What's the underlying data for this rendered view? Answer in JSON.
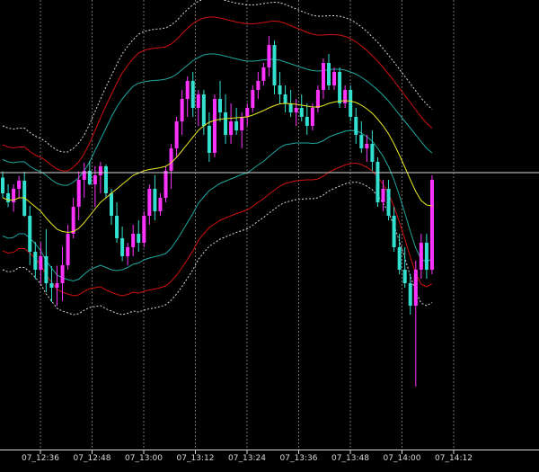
{
  "chart_data": {
    "type": "candlestick",
    "title": "",
    "x_ticks": [
      "07_12:36",
      "07_12:48",
      "07_13:00",
      "07_13:12",
      "07_13:24",
      "07_13:36",
      "07_13:48",
      "07_14:00",
      "07_14:12"
    ],
    "ylim": [
      0,
      100
    ],
    "grid": "vertical dashed",
    "price_line_y": 61.6,
    "colors": {
      "background": "#000000",
      "up_candle": "#ff33ff",
      "down_candle": "#33e0d0",
      "moving_average": "#e8e820",
      "band_inner": "#1fa7a0",
      "band_middle": "#d01010",
      "band_outer": "#d8d8d8",
      "price_line": "#d8d8d8",
      "grid": "#ffffff"
    },
    "candles": [
      {
        "o": 60.5,
        "h": 61.9,
        "l": 56.0,
        "c": 57.0
      },
      {
        "o": 57.0,
        "h": 59.0,
        "l": 53.9,
        "c": 55.0
      },
      {
        "o": 55.0,
        "h": 59.0,
        "l": 52.9,
        "c": 58.0
      },
      {
        "o": 58.0,
        "h": 60.9,
        "l": 55.8,
        "c": 59.8
      },
      {
        "o": 59.8,
        "h": 61.8,
        "l": 51.8,
        "c": 52.0
      },
      {
        "o": 52.0,
        "h": 54.2,
        "l": 41.0,
        "c": 44.0
      },
      {
        "o": 44.0,
        "h": 46.2,
        "l": 37.9,
        "c": 40.0
      },
      {
        "o": 40.0,
        "h": 46.0,
        "l": 36.9,
        "c": 43.0
      },
      {
        "o": 43.0,
        "h": 49.0,
        "l": 35.0,
        "c": 37.0
      },
      {
        "o": 37.0,
        "h": 40.8,
        "l": 32.8,
        "c": 36.0
      },
      {
        "o": 36.0,
        "h": 40.9,
        "l": 31.9,
        "c": 37.0
      },
      {
        "o": 37.0,
        "h": 45.1,
        "l": 33.0,
        "c": 41.0
      },
      {
        "o": 41.0,
        "h": 50.0,
        "l": 40.0,
        "c": 48.0
      },
      {
        "o": 48.0,
        "h": 56.0,
        "l": 47.0,
        "c": 54.0
      },
      {
        "o": 54.0,
        "h": 61.9,
        "l": 51.0,
        "c": 60.0
      },
      {
        "o": 60.0,
        "h": 63.8,
        "l": 56.0,
        "c": 62.0
      },
      {
        "o": 62.0,
        "h": 64.2,
        "l": 58.8,
        "c": 59.0
      },
      {
        "o": 59.0,
        "h": 63.0,
        "l": 54.0,
        "c": 61.0
      },
      {
        "o": 61.0,
        "h": 64.0,
        "l": 57.0,
        "c": 63.0
      },
      {
        "o": 63.0,
        "h": 63.4,
        "l": 56.0,
        "c": 57.0
      },
      {
        "o": 57.0,
        "h": 58.0,
        "l": 50.0,
        "c": 52.0
      },
      {
        "o": 52.0,
        "h": 55.0,
        "l": 46.0,
        "c": 47.0
      },
      {
        "o": 47.0,
        "h": 49.6,
        "l": 41.9,
        "c": 43.0
      },
      {
        "o": 43.0,
        "h": 46.0,
        "l": 41.0,
        "c": 45.0
      },
      {
        "o": 45.0,
        "h": 50.0,
        "l": 43.0,
        "c": 48.0
      },
      {
        "o": 48.0,
        "h": 51.0,
        "l": 44.0,
        "c": 46.0
      },
      {
        "o": 46.0,
        "h": 53.0,
        "l": 45.0,
        "c": 52.0
      },
      {
        "o": 52.0,
        "h": 59.0,
        "l": 50.0,
        "c": 58.0
      },
      {
        "o": 58.0,
        "h": 61.0,
        "l": 51.0,
        "c": 53.0
      },
      {
        "o": 53.0,
        "h": 57.0,
        "l": 52.0,
        "c": 56.0
      },
      {
        "o": 56.0,
        "h": 63.0,
        "l": 55.0,
        "c": 62.0
      },
      {
        "o": 62.0,
        "h": 68.0,
        "l": 58.0,
        "c": 67.0
      },
      {
        "o": 67.0,
        "h": 74.0,
        "l": 65.0,
        "c": 73.0
      },
      {
        "o": 73.0,
        "h": 80.0,
        "l": 70.0,
        "c": 78.0
      },
      {
        "o": 78.0,
        "h": 83.0,
        "l": 74.0,
        "c": 82.0
      },
      {
        "o": 82.0,
        "h": 84.0,
        "l": 74.0,
        "c": 76.0
      },
      {
        "o": 76.0,
        "h": 80.0,
        "l": 72.0,
        "c": 79.0
      },
      {
        "o": 79.0,
        "h": 80.0,
        "l": 70.0,
        "c": 72.0
      },
      {
        "o": 72.0,
        "h": 75.0,
        "l": 64.0,
        "c": 66.0
      },
      {
        "o": 66.0,
        "h": 79.0,
        "l": 65.0,
        "c": 78.0
      },
      {
        "o": 78.0,
        "h": 82.0,
        "l": 73.0,
        "c": 75.0
      },
      {
        "o": 75.0,
        "h": 79.0,
        "l": 68.0,
        "c": 70.0
      },
      {
        "o": 70.0,
        "h": 77.0,
        "l": 68.0,
        "c": 73.0
      },
      {
        "o": 73.0,
        "h": 76.0,
        "l": 70.0,
        "c": 71.0
      },
      {
        "o": 71.0,
        "h": 75.0,
        "l": 67.0,
        "c": 74.0
      },
      {
        "o": 74.0,
        "h": 77.0,
        "l": 72.0,
        "c": 76.0
      },
      {
        "o": 76.0,
        "h": 81.0,
        "l": 75.0,
        "c": 80.0
      },
      {
        "o": 80.0,
        "h": 84.0,
        "l": 78.0,
        "c": 82.0
      },
      {
        "o": 82.0,
        "h": 86.0,
        "l": 81.0,
        "c": 85.0
      },
      {
        "o": 85.0,
        "h": 92.0,
        "l": 83.0,
        "c": 90.0
      },
      {
        "o": 90.0,
        "h": 91.0,
        "l": 79.0,
        "c": 81.0
      },
      {
        "o": 81.0,
        "h": 84.0,
        "l": 77.0,
        "c": 79.0
      },
      {
        "o": 79.0,
        "h": 81.0,
        "l": 75.0,
        "c": 77.0
      },
      {
        "o": 77.0,
        "h": 80.0,
        "l": 74.0,
        "c": 75.0
      },
      {
        "o": 75.0,
        "h": 78.0,
        "l": 72.0,
        "c": 76.0
      },
      {
        "o": 76.0,
        "h": 79.0,
        "l": 73.0,
        "c": 74.0
      },
      {
        "o": 74.0,
        "h": 77.0,
        "l": 70.0,
        "c": 72.0
      },
      {
        "o": 72.0,
        "h": 77.0,
        "l": 71.0,
        "c": 76.0
      },
      {
        "o": 76.0,
        "h": 81.0,
        "l": 75.0,
        "c": 80.0
      },
      {
        "o": 80.0,
        "h": 87.0,
        "l": 78.0,
        "c": 86.0
      },
      {
        "o": 86.0,
        "h": 88.0,
        "l": 80.0,
        "c": 81.0
      },
      {
        "o": 81.0,
        "h": 85.0,
        "l": 80.0,
        "c": 84.0
      },
      {
        "o": 84.0,
        "h": 85.0,
        "l": 76.0,
        "c": 77.0
      },
      {
        "o": 77.0,
        "h": 81.0,
        "l": 76.0,
        "c": 80.0
      },
      {
        "o": 80.0,
        "h": 81.0,
        "l": 73.0,
        "c": 74.0
      },
      {
        "o": 74.0,
        "h": 76.0,
        "l": 68.0,
        "c": 70.0
      },
      {
        "o": 70.0,
        "h": 73.0,
        "l": 66.0,
        "c": 67.0
      },
      {
        "o": 67.0,
        "h": 70.0,
        "l": 64.0,
        "c": 68.0
      },
      {
        "o": 68.0,
        "h": 71.0,
        "l": 62.0,
        "c": 64.0
      },
      {
        "o": 64.0,
        "h": 65.0,
        "l": 54.0,
        "c": 55.0
      },
      {
        "o": 55.0,
        "h": 60.0,
        "l": 53.0,
        "c": 58.0
      },
      {
        "o": 58.0,
        "h": 60.0,
        "l": 51.0,
        "c": 52.0
      },
      {
        "o": 52.0,
        "h": 54.0,
        "l": 44.0,
        "c": 45.0
      },
      {
        "o": 45.0,
        "h": 48.0,
        "l": 39.0,
        "c": 40.0
      },
      {
        "o": 40.0,
        "h": 45.0,
        "l": 36.0,
        "c": 37.0
      },
      {
        "o": 37.0,
        "h": 39.0,
        "l": 30.0,
        "c": 32.0
      },
      {
        "o": 32.0,
        "h": 42.0,
        "l": 14.0,
        "c": 40.0
      },
      {
        "o": 40.0,
        "h": 48.0,
        "l": 38.0,
        "c": 46.0
      },
      {
        "o": 46.0,
        "h": 48.0,
        "l": 38.0,
        "c": 40.0
      },
      {
        "o": 40.0,
        "h": 61.0,
        "l": 39.0,
        "c": 60.0
      }
    ],
    "moving_average": [
      56,
      55.5,
      55.5,
      56,
      56,
      55,
      54,
      53,
      51.5,
      50.2,
      49,
      48.5,
      48.3,
      48.5,
      49.2,
      50.5,
      52,
      53.5,
      55,
      56,
      57,
      58,
      59,
      60,
      61,
      61.5,
      62,
      62.3,
      62.5,
      62.7,
      63,
      63.8,
      65,
      66.5,
      68,
      69.5,
      71,
      72,
      72.8,
      73.2,
      73.5,
      73.6,
      73.7,
      73.8,
      73.9,
      74,
      74.4,
      74.9,
      75.4,
      76,
      76.5,
      76.9,
      77,
      76.9,
      76.8,
      76.6,
      76.4,
      76.2,
      76.2,
      76.5,
      77,
      77.3,
      77.5,
      77.6,
      77.5,
      77.2,
      76.6,
      75.8,
      74.8,
      73.5,
      72,
      70.2,
      68,
      65.5,
      62.8,
      60,
      57.4,
      55.4,
      54.4,
      54.2
    ],
    "bands": {
      "inner_upper": [
        64.5,
        64,
        63.8,
        64,
        64,
        63,
        62.3,
        61.8,
        61,
        60,
        59.2,
        58.8,
        58.8,
        59.5,
        60.5,
        62,
        64,
        66.5,
        69,
        71.5,
        74,
        76.2,
        78,
        79.5,
        80.8,
        81.5,
        81.8,
        82,
        82.1,
        82.2,
        82.4,
        82.8,
        83.5,
        84.5,
        85.5,
        86.5,
        87.2,
        87.8,
        88,
        88,
        87.8,
        87.5,
        87.2,
        86.9,
        86.6,
        86.4,
        86.4,
        86.5,
        86.7,
        86.8,
        86.8,
        86.6,
        86.2,
        85.8,
        85.4,
        85,
        84.6,
        84.3,
        84.2,
        84.3,
        84.5,
        84.6,
        84.6,
        84.4,
        84,
        83.5,
        82.8,
        82,
        81,
        80,
        78.8,
        77.5,
        76,
        74.5,
        73,
        71.5,
        70,
        68.5,
        67,
        66
      ],
      "inner_lower": [
        47.5,
        47,
        47.2,
        48,
        48,
        47,
        45.8,
        44.2,
        42,
        40.4,
        38.8,
        38.2,
        37.8,
        37.5,
        37.9,
        39,
        40,
        40.5,
        41,
        40.5,
        40,
        39.8,
        40,
        40.5,
        41.2,
        41.5,
        42.2,
        42.6,
        42.9,
        43.2,
        43.6,
        44.8,
        46.5,
        48.5,
        50.5,
        52.5,
        54.8,
        56.2,
        57.6,
        58.4,
        59.2,
        59.7,
        60.2,
        60.7,
        61.2,
        61.6,
        62.4,
        63.3,
        64.1,
        65.2,
        66.2,
        67.2,
        67.8,
        68,
        68.2,
        68.2,
        68.2,
        68.1,
        68.2,
        68.7,
        69.5,
        70,
        70.4,
        70.8,
        71,
        70.9,
        70.4,
        69.6,
        68.6,
        67,
        65.2,
        62.9,
        60,
        56.5,
        52.6,
        48.5,
        44.8,
        42.3,
        41.8,
        42.4
      ],
      "middle_upper": [
        67.8,
        67.3,
        67.1,
        67.3,
        67.3,
        66.3,
        65.5,
        65,
        64.2,
        63.2,
        62.4,
        62,
        62,
        62.8,
        64,
        65.8,
        68.2,
        71,
        73.8,
        76.5,
        79,
        81.5,
        83.8,
        85.5,
        87,
        88.2,
        88.8,
        89.1,
        89.3,
        89.4,
        89.6,
        90.2,
        91.2,
        92.5,
        93.7,
        94.8,
        95.5,
        96,
        96.2,
        96.2,
        96,
        95.7,
        95.4,
        95.1,
        94.9,
        94.7,
        94.7,
        94.8,
        95,
        95.2,
        95.3,
        95.2,
        94.8,
        94.3,
        93.8,
        93.3,
        92.8,
        92.4,
        92.2,
        92.2,
        92.3,
        92.3,
        92.2,
        91.9,
        91.4,
        90.7,
        89.8,
        88.8,
        87.6,
        86.4,
        85,
        83.5,
        82,
        80.4,
        78.8,
        77.2,
        75.6,
        74,
        72.6,
        71.5
      ],
      "middle_lower": [
        44.2,
        43.7,
        43.9,
        44.7,
        44.7,
        43.7,
        42.5,
        41,
        38.8,
        37.2,
        35.6,
        35,
        34.6,
        34.2,
        34.4,
        35.2,
        35.8,
        36,
        36.2,
        35.5,
        35,
        34.5,
        34.2,
        34.5,
        35,
        34.8,
        35.2,
        35.5,
        35.7,
        36,
        36.4,
        37.4,
        38.8,
        40.5,
        42.3,
        44.2,
        46.5,
        48,
        49.4,
        50.2,
        51,
        51.5,
        52,
        52.5,
        52.9,
        53.3,
        54.1,
        55,
        55.8,
        56.8,
        57.7,
        58.6,
        59.2,
        59.5,
        59.8,
        59.9,
        60,
        60,
        60.2,
        60.8,
        61.7,
        62.3,
        62.8,
        63.3,
        63.6,
        63.7,
        63.4,
        62.8,
        62,
        60.6,
        59,
        56.9,
        54,
        50.6,
        46.8,
        42.8,
        39.2,
        36.8,
        36.2,
        36.9
      ],
      "outer_upper": [
        72,
        71.5,
        71.3,
        71.5,
        71.5,
        70.5,
        69.7,
        69.2,
        68.4,
        67.4,
        66.6,
        66.2,
        66.2,
        67,
        68.2,
        70,
        72.4,
        75.2,
        78,
        80.7,
        83.2,
        85.7,
        88,
        89.7,
        91.2,
        92.4,
        93,
        93.3,
        93.5,
        93.6,
        93.8,
        94.4,
        95.4,
        96.7,
        97.9,
        99,
        99.7,
        100.2,
        100.4,
        100.4,
        100.2,
        99.9,
        99.6,
        99.3,
        99.1,
        98.9,
        98.9,
        99,
        99.2,
        99.4,
        99.5,
        99.4,
        99,
        98.5,
        98,
        97.5,
        97,
        96.6,
        96.4,
        96.4,
        96.5,
        96.5,
        96.4,
        96.1,
        95.6,
        94.9,
        94,
        93,
        91.8,
        90.6,
        89.2,
        87.7,
        86.2,
        84.6,
        83,
        81.4,
        79.8,
        78.2,
        76.8,
        75.7
      ],
      "outer_lower": [
        40,
        39.5,
        39.7,
        40.5,
        40.5,
        39.5,
        38.3,
        36.8,
        34.6,
        33,
        31.4,
        30.8,
        30.4,
        30,
        30.2,
        31,
        31.6,
        31.8,
        32,
        31.3,
        30.8,
        30.3,
        30,
        30.3,
        30.8,
        30.6,
        31,
        31.3,
        31.5,
        31.8,
        32.2,
        33.2,
        34.6,
        36.3,
        38.1,
        40,
        42.3,
        43.8,
        45.2,
        46,
        46.8,
        47.3,
        47.8,
        48.3,
        48.7,
        49.1,
        49.9,
        50.8,
        51.6,
        52.6,
        53.5,
        54.4,
        55,
        55.3,
        55.6,
        55.7,
        55.8,
        55.8,
        56,
        56.6,
        57.5,
        58.1,
        58.6,
        59.1,
        59.4,
        59.5,
        59.2,
        58.6,
        57.8,
        56.4,
        54.8,
        52.7,
        49.8,
        46.4,
        42.6,
        38.6,
        35,
        32.6,
        32,
        32.7
      ]
    }
  }
}
